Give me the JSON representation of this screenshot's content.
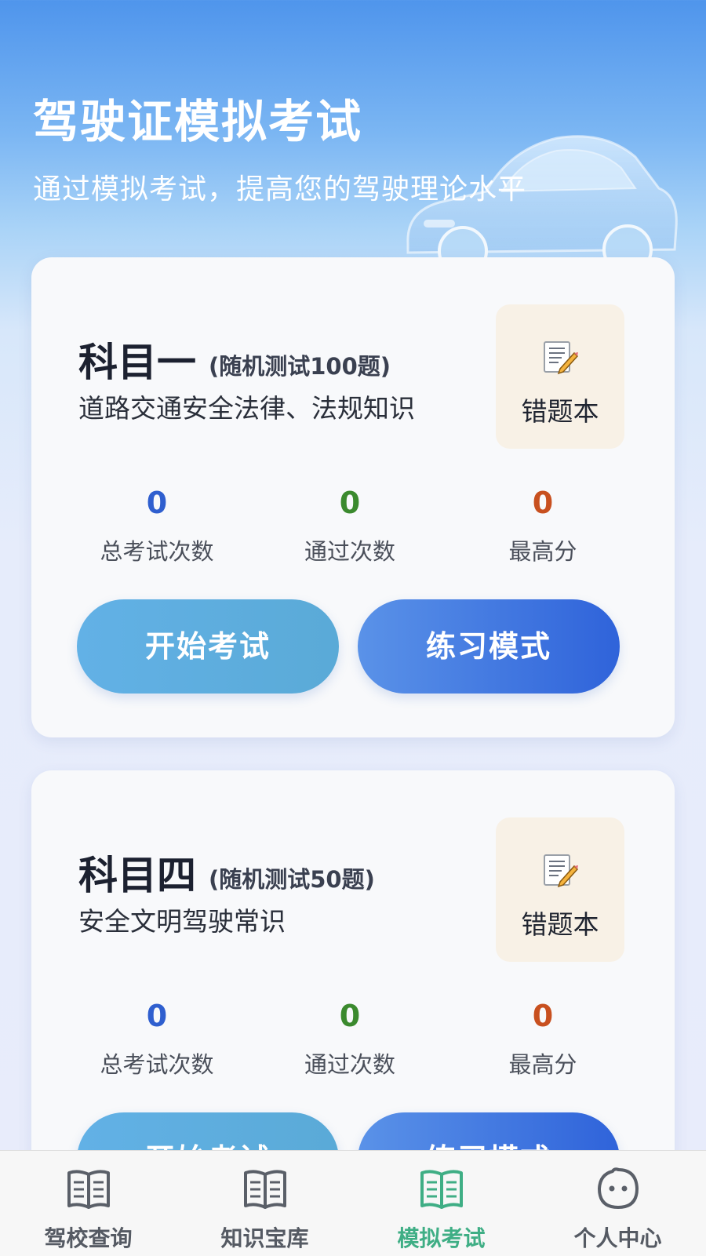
{
  "header": {
    "title": "驾驶证模拟考试",
    "subtitle": "通过模拟考试，提高您的驾驶理论水平"
  },
  "subjects": [
    {
      "name": "科目一",
      "note": "(随机测试100题)",
      "description": "道路交通安全法律、法规知识",
      "wrongbook_label": "错题本",
      "stats": [
        {
          "value": "0",
          "label": "总考试次数",
          "color": "#2f5fcf"
        },
        {
          "value": "0",
          "label": "通过次数",
          "color": "#3b8a2e"
        },
        {
          "value": "0",
          "label": "最高分",
          "color": "#c8501f"
        }
      ],
      "start_label": "开始考试",
      "practice_label": "练习模式"
    },
    {
      "name": "科目四",
      "note": "(随机测试50题)",
      "description": "安全文明驾驶常识",
      "wrongbook_label": "错题本",
      "stats": [
        {
          "value": "0",
          "label": "总考试次数",
          "color": "#2f5fcf"
        },
        {
          "value": "0",
          "label": "通过次数",
          "color": "#3b8a2e"
        },
        {
          "value": "0",
          "label": "最高分",
          "color": "#c8501f"
        }
      ],
      "start_label": "开始考试",
      "practice_label": "练习模式"
    }
  ],
  "nav": {
    "items": [
      {
        "label": "驾校查询",
        "icon": "book-icon",
        "active": false
      },
      {
        "label": "知识宝库",
        "icon": "book-icon",
        "active": false
      },
      {
        "label": "模拟考试",
        "icon": "book-icon",
        "active": true
      },
      {
        "label": "个人中心",
        "icon": "face-icon",
        "active": false
      }
    ],
    "active_color": "#3fae85"
  },
  "colors": {
    "accent": "#2f63da",
    "start_button": "#5aaad7"
  }
}
